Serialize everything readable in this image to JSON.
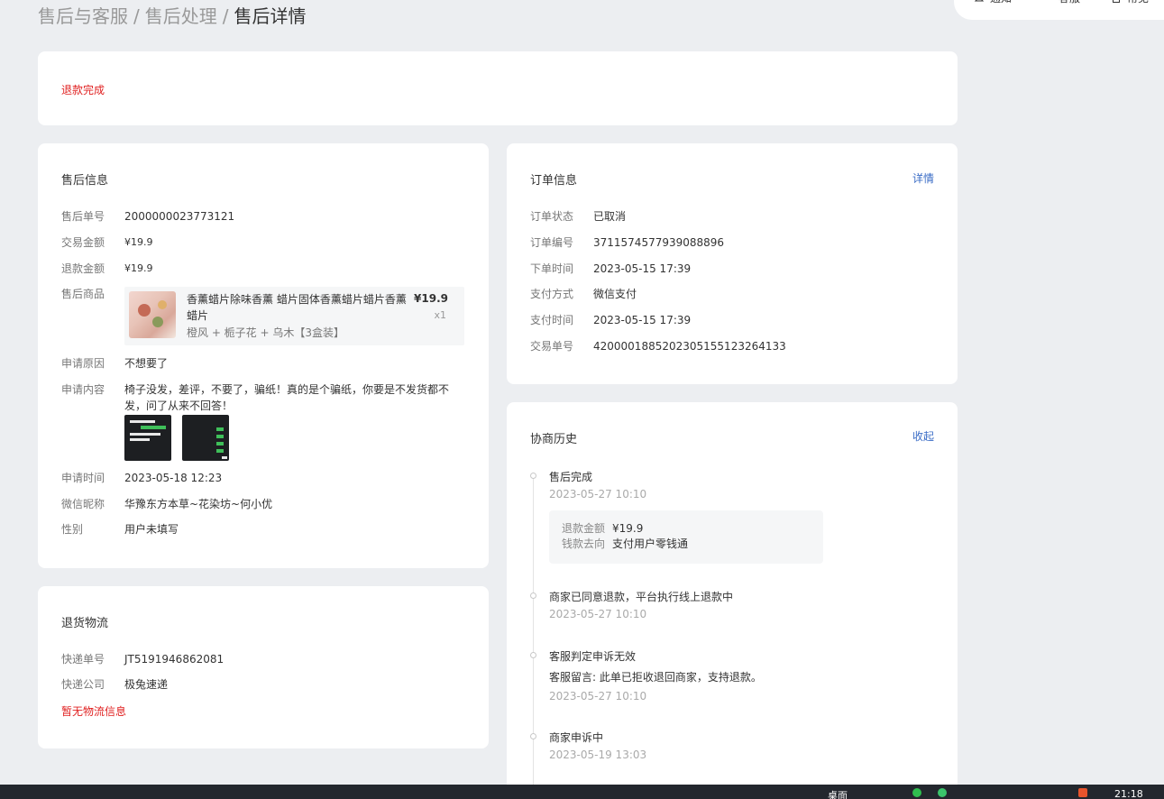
{
  "breadcrumb": {
    "level1": "售后与客服",
    "level2": "售后处理",
    "current": "售后详情",
    "sep": "/"
  },
  "topbar": {
    "notify": "通知",
    "service": "客服",
    "common": "常见"
  },
  "status": {
    "text": "退款完成"
  },
  "after_sale": {
    "title": "售后信息",
    "rows": [
      {
        "label": "售后单号",
        "value": "2000000023773121"
      },
      {
        "label": "交易金额",
        "value": "¥19.9"
      },
      {
        "label": "退款金额",
        "value": "¥19.9"
      }
    ],
    "product_label": "售后商品",
    "product": {
      "title": "香薰蜡片除味香薰 蜡片固体香薰蜡片蜡片香薰 蜡片",
      "spec": "橙风 + 栀子花 + 乌木【3盒装】",
      "price": "¥19.9",
      "qty": "x1"
    },
    "reason_label": "申请原因",
    "reason": "不想要了",
    "content_label": "申请内容",
    "content": "椅子没发，差评，不要了，骗纸！真的是个骗纸，你要是不发货都不发，问了从来不回答！",
    "time_label": "申请时间",
    "time": "2023-05-18 12:23",
    "nickname_label": "微信昵称",
    "nickname": "华豫东方本草~花染坊~何小优",
    "gender_label": "性别",
    "gender": "用户未填写"
  },
  "order": {
    "title": "订单信息",
    "link": "详情",
    "rows": [
      {
        "label": "订单状态",
        "value": "已取消"
      },
      {
        "label": "订单编号",
        "value": "3711574577939088896"
      },
      {
        "label": "下单时间",
        "value": "2023-05-15 17:39"
      },
      {
        "label": "支付方式",
        "value": "微信支付"
      },
      {
        "label": "支付时间",
        "value": "2023-05-15 17:39"
      },
      {
        "label": "交易单号",
        "value": "4200001885202305155123264133"
      }
    ]
  },
  "logistics": {
    "title": "退货物流",
    "rows": [
      {
        "label": "快递单号",
        "value": "JT5191946862081"
      },
      {
        "label": "快递公司",
        "value": "极兔速递"
      }
    ],
    "empty": "暂无物流信息"
  },
  "history": {
    "title": "协商历史",
    "link": "收起",
    "items": [
      {
        "title": "售后完成",
        "time": "2023-05-27 10:10",
        "box": [
          {
            "k": "退款金额",
            "v": "¥19.9"
          },
          {
            "k": "钱款去向",
            "v": "支付用户零钱通"
          }
        ]
      },
      {
        "title": "商家已同意退款，平台执行线上退款中",
        "time": "2023-05-27 10:10"
      },
      {
        "title": "客服判定申诉无效",
        "sub": "客服留言: 此单已拒收退回商家，支持退款。",
        "time": "2023-05-27 10:10"
      },
      {
        "title": "商家申诉中",
        "time": "2023-05-19 13:03"
      }
    ]
  },
  "taskbar": {
    "desktop": "桌面",
    "clock": "21:18"
  }
}
